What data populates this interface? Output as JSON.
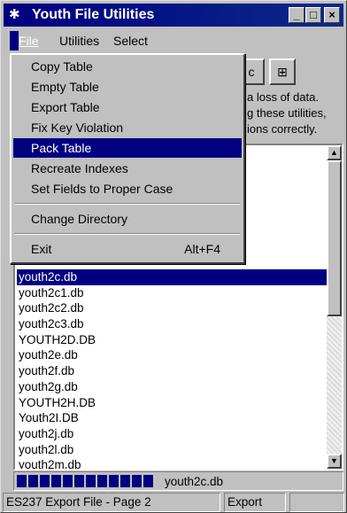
{
  "window": {
    "title": "Youth File Utilities",
    "icon": "app-icon",
    "minimize": "_",
    "maximize": "□",
    "close": "×"
  },
  "menubar": {
    "file": "File",
    "utilities": "Utilities",
    "select": "Select"
  },
  "toolbar": {
    "btn1_glyph": "c",
    "btn2_icon": "tree-icon",
    "btn2_glyph": "⊞"
  },
  "message": {
    "line1": "a loss of data.",
    "line2": "g these utilities,",
    "line3": "ions correctly."
  },
  "file_menu": {
    "items": [
      {
        "label": "Copy Table"
      },
      {
        "label": "Empty Table"
      },
      {
        "label": "Export Table"
      },
      {
        "label": "Fix Key Violation"
      },
      {
        "label": "Pack Table"
      },
      {
        "label": "Recreate Indexes"
      },
      {
        "label": "Set Fields to Proper Case"
      },
      {
        "label": "Change Directory"
      },
      {
        "label": "Exit",
        "shortcut": "Alt+F4"
      }
    ],
    "highlighted": "Pack Table"
  },
  "file_list": {
    "items": [
      "youth2c.db",
      "youth2c1.db",
      "youth2c2.db",
      "youth2c3.db",
      "YOUTH2D.DB",
      "youth2e.db",
      "youth2f.db",
      "youth2g.db",
      "YOUTH2H.DB",
      "Youth2I.DB",
      "youth2j.db",
      "youth2l.db",
      "youth2m.db"
    ],
    "selected": "youth2c.db"
  },
  "progress": {
    "filename": "youth2c.db",
    "segments": 12
  },
  "statusbar": {
    "panel1": "ES237 Export File - Page 2",
    "panel2": "Export",
    "panel3": ""
  }
}
